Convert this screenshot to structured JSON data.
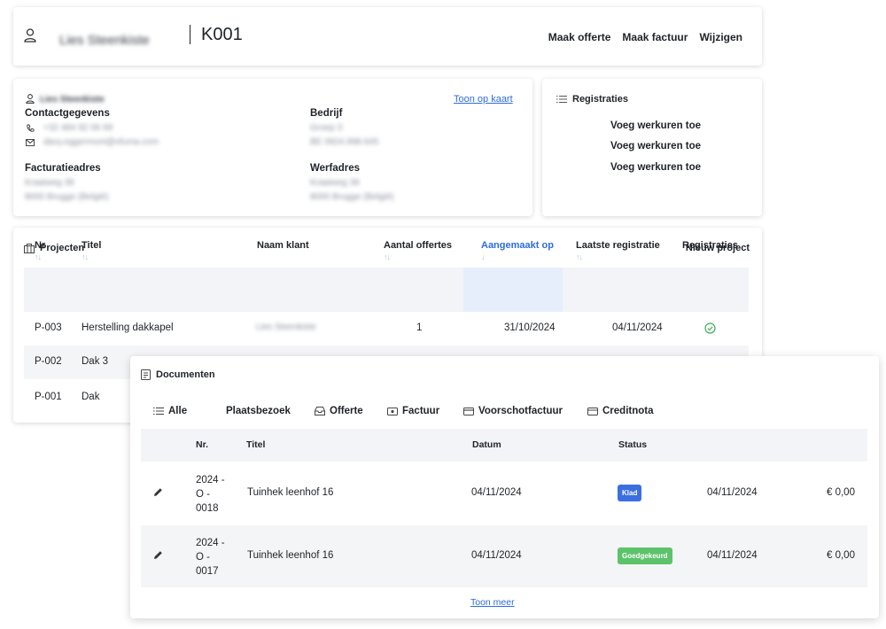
{
  "header": {
    "client_name": "Lies Steenkiste",
    "customer_code": "K001",
    "actions": {
      "quote": "Maak offerte",
      "invoice": "Maak factuur",
      "edit": "Wijzigen"
    }
  },
  "info": {
    "contact_name": "Lies Steenkiste",
    "contact_heading": "Contactgegevens",
    "phone": "+32 484 92 06 69",
    "email": "davy.eggermont@xfuma.com",
    "company_heading": "Bedrijf",
    "company_name": "Groep 3",
    "vat": "BE 0924.998.645",
    "map_link": "Toon op kaart",
    "billing_heading": "Facturatieadres",
    "billing_street": "Kraaiweg 39",
    "billing_city": "8000 Brugge (België)",
    "site_heading": "Werfadres",
    "site_street": "Kraaiweg 39",
    "site_city": "8000 Brugge (België)"
  },
  "registrations": {
    "title": "Registraties",
    "items": [
      "Voeg werkuren toe",
      "Voeg werkuren toe",
      "Voeg werkuren toe"
    ]
  },
  "projects": {
    "title": "Projecten",
    "new_label": "Nieuw project",
    "columns": [
      "Nr",
      "Titel",
      "Naam klant",
      "Aantal offertes",
      "Aangemaakt op",
      "Laatste registratie",
      "Registraties"
    ],
    "sort_glyph": "↑↓",
    "sort_active": "↓",
    "rows": [
      {
        "nr": "P-003",
        "title": "Herstelling dakkapel",
        "client": "Lies Steenkiste",
        "quotes": "1",
        "created": "31/10/2024",
        "last": "04/11/2024"
      },
      {
        "nr": "P-002",
        "title": "Dak 3"
      },
      {
        "nr": "P-001",
        "title": "Dak"
      }
    ]
  },
  "documents": {
    "title": "Documenten",
    "filters": [
      "Alle",
      "Plaatsbezoek",
      "Offerte",
      "Factuur",
      "Voorschotfactuur",
      "Creditnota"
    ],
    "columns": {
      "nr": "Nr.",
      "title": "Titel",
      "date": "Datum",
      "status": "Status"
    },
    "rows": [
      {
        "nr1": "2024 -",
        "nr2": "O -",
        "nr3": "0018",
        "title": "Tuinhek leenhof 16",
        "date": "04/11/2024",
        "status": "Klad",
        "status_color": "#3b6fe0",
        "date2": "04/11/2024",
        "amount": "€ 0,00"
      },
      {
        "nr1": "2024 -",
        "nr2": "O -",
        "nr3": "0017",
        "title": "Tuinhek leenhof 16",
        "date": "04/11/2024",
        "status": "Goedgekeurd",
        "status_color": "#5cc36a",
        "date2": "04/11/2024",
        "amount": "€ 0,00"
      }
    ],
    "more_label": "Toon meer"
  }
}
